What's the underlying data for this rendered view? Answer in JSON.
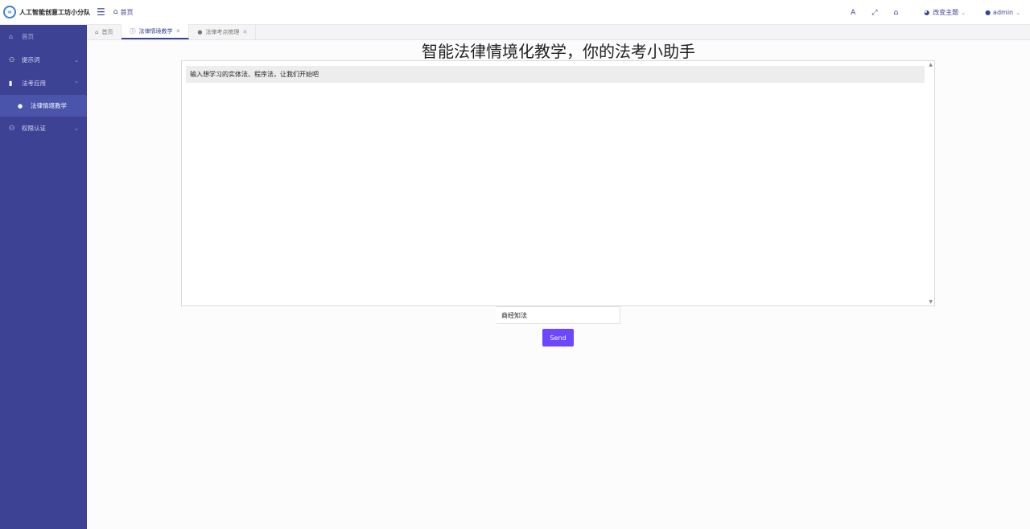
{
  "header": {
    "brand_title": "人工智能创意工坊小分队",
    "brand_logo": "∞",
    "breadcrumb": "首页",
    "tools": {
      "font": "A",
      "fullscreen": "⤢",
      "home": "⌂"
    },
    "theme_label": "改变主题",
    "user_label": "admin"
  },
  "sidebar": {
    "items": [
      {
        "label": "首页"
      },
      {
        "label": "提示词"
      },
      {
        "label": "法考应用"
      },
      {
        "label": "法律情境教学"
      },
      {
        "label": "权限认证"
      }
    ]
  },
  "tabs": [
    {
      "label": "首页"
    },
    {
      "label": "法律情境教学"
    },
    {
      "label": "法律考点梳理"
    }
  ],
  "main": {
    "title": "智能法律情境化教学，你的法考小助手",
    "chat_message": "输入想学习的实体法、程序法，让我们开始吧",
    "input_value": "商经知法",
    "send_label": "Send"
  },
  "colors": {
    "sidebar_bg": "#3d4295",
    "accent": "#3d4295",
    "send_button": "#6c47ff"
  }
}
